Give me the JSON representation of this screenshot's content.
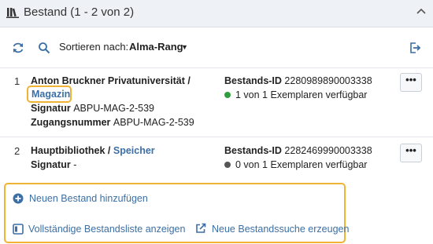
{
  "header": {
    "title": "Bestand (1 - 2 von 2)",
    "books_icon": "books-icon",
    "collapse_icon": "chevron-up-icon"
  },
  "toolbar": {
    "sort_label": "Sortieren nach:",
    "sort_value": "Alma-Rang",
    "sort_caret": "▼"
  },
  "items": [
    {
      "number": "1",
      "library": "Anton Bruckner Privatuniversität /",
      "location": "Magazin",
      "signatur_label": "Signatur",
      "signatur_value": "ABPU-MAG-2-539",
      "zugang_label": "Zugangsnummer",
      "zugang_value": "ABPU-MAG-2-539",
      "holding_id_label": "Bestands-ID",
      "holding_id_value": "2280989890003338",
      "availability": "1 von 1 Exemplaren verfügbar",
      "status_color": "#2e9e3e",
      "more": "•••"
    },
    {
      "number": "2",
      "library": "Hauptbibliothek /",
      "location": "Speicher",
      "signatur_label": "Signatur",
      "signatur_value": "-",
      "holding_id_label": "Bestands-ID",
      "holding_id_value": "2282469990003338",
      "availability": "0 von 1 Exemplaren verfügbar",
      "status_color": "#555555",
      "more": "•••"
    }
  ],
  "actions": {
    "add": "Neuen Bestand hinzufügen",
    "full_list": "Vollständige Bestandsliste anzeigen",
    "new_search": "Neue Bestandssuche erzeugen"
  },
  "colors": {
    "accent": "#3b6fa5",
    "highlight": "#f2b233",
    "header_bg": "#eef2f7"
  }
}
